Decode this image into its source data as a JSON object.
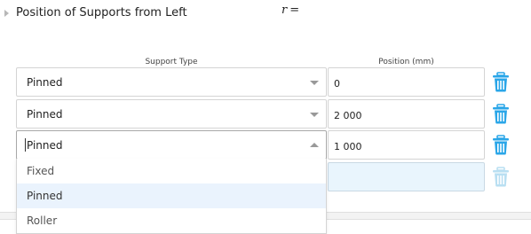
{
  "section": {
    "title": "Position of Supports from Left",
    "variable": "r",
    "equals": "="
  },
  "columns": {
    "support_type": "Support Type",
    "position": "Position (mm)"
  },
  "rows": [
    {
      "support_type": "Pinned",
      "position": "0"
    },
    {
      "support_type": "Pinned",
      "position": "2 000"
    },
    {
      "support_type": "Pinned",
      "position": "1 000"
    },
    {
      "support_type": "",
      "position": ""
    }
  ],
  "dropdown": {
    "options": [
      "Fixed",
      "Pinned",
      "Roller"
    ],
    "selected": "Pinned"
  },
  "colors": {
    "accent": "#2aa6e8",
    "accent_disabled": "#b9dff2",
    "selected_option_bg": "#eaf3fd",
    "empty_input_bg": "#e9f5fd"
  },
  "icons": {
    "trash": "trash-icon",
    "expand": "expand-triangle-icon"
  }
}
